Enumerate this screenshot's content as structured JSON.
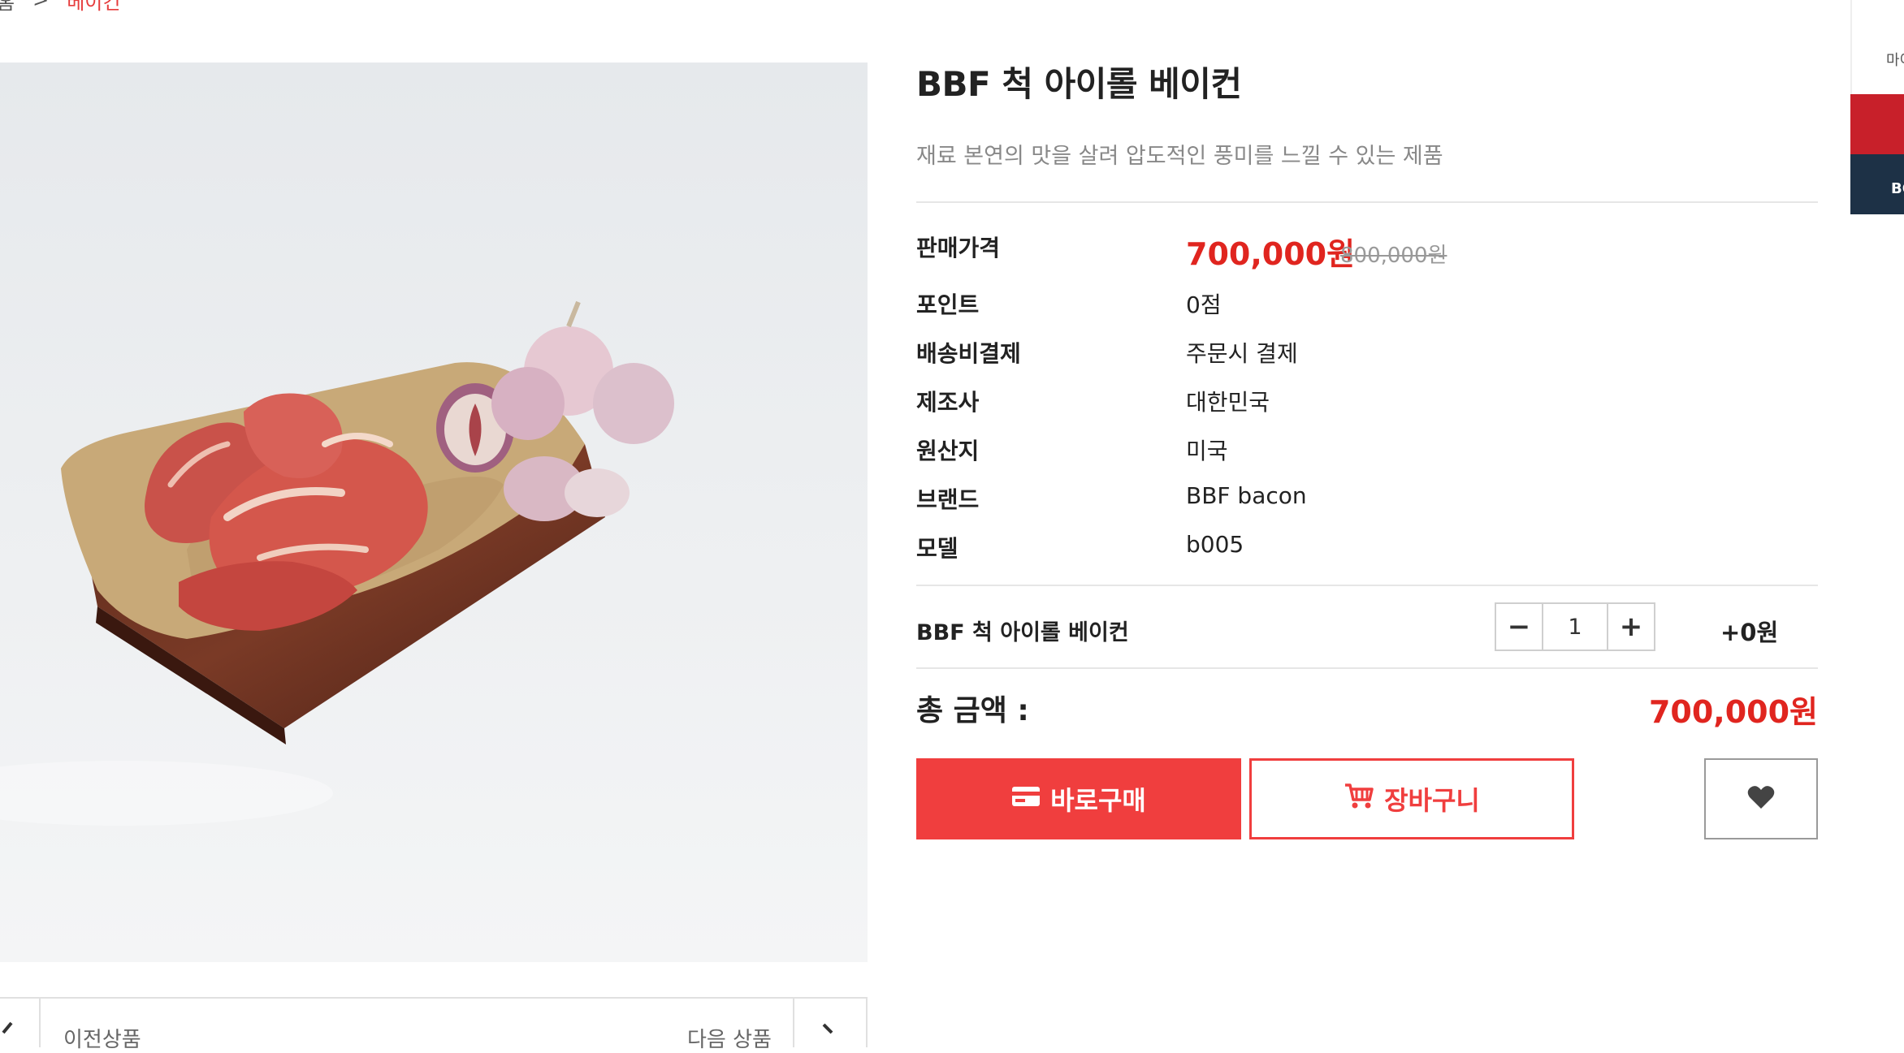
{
  "breadcrumb": {
    "home": "홈",
    "separator": ">",
    "current": "베이컨"
  },
  "product": {
    "title": "BBF 척 아이롤 베이컨",
    "subtitle": "재료 본연의 맛을 살려 압도적인 풍미를 느낄 수 있는 제품",
    "specs": {
      "price_label": "판매가격",
      "sale_price": "700,000원",
      "original_price": "800,000원",
      "points_label": "포인트",
      "points_value": "0점",
      "shipping_label": "배송비결제",
      "shipping_value": "주문시 결제",
      "maker_label": "제조사",
      "maker_value": "대한민국",
      "origin_label": "원산지",
      "origin_value": "미국",
      "brand_label": "브랜드",
      "brand_value": "BBF bacon",
      "model_label": "모델",
      "model_value": "b005"
    }
  },
  "option": {
    "name": "BBF 척 아이롤 베이컨",
    "minus": "−",
    "quantity": "1",
    "plus": "+",
    "price": "+0원"
  },
  "total": {
    "label": "총 금액 :",
    "value": "700,000원"
  },
  "actions": {
    "buy_label": "바로구매",
    "cart_label": "장바구니",
    "wish_icon": "heart-icon"
  },
  "product_nav": {
    "prev_label": "이전상품",
    "next_label": "다음 상품"
  },
  "side_panel": {
    "top_text": "마이",
    "bottom_text": "BO"
  },
  "colors": {
    "accent": "#f03e3e",
    "price": "#e0251f",
    "navy": "#1d3146"
  }
}
